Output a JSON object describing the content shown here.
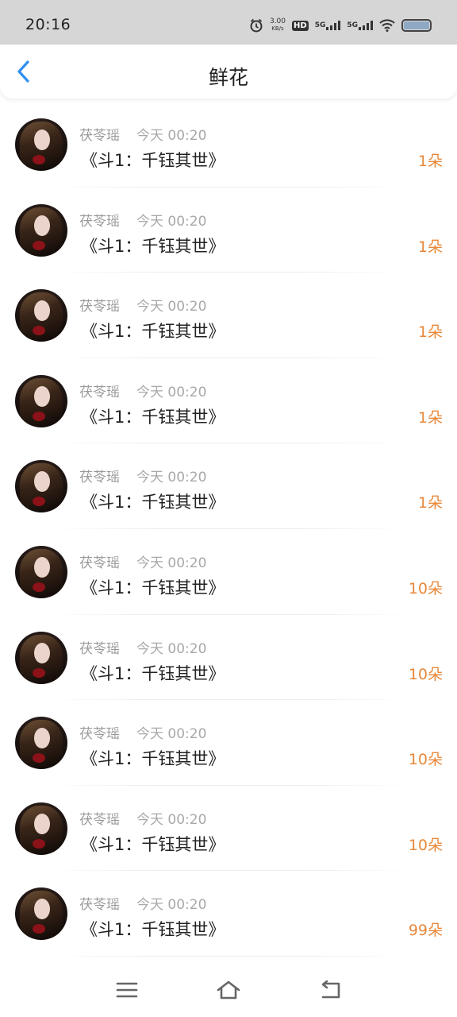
{
  "status_bar": {
    "time": "20:16",
    "net_speed_value": "3.00",
    "net_speed_unit": "KB/s",
    "hd_label": "HD",
    "sim1_label": "5G",
    "sim2_label": "5G"
  },
  "header": {
    "title": "鲜花"
  },
  "colors": {
    "accent_back": "#2f8ff0",
    "count_orange": "#e8883a"
  },
  "rows": [
    {
      "name": "茯苓瑶",
      "time": "今天 00:20",
      "book": "《斗1：千钰其世》",
      "count": "1朵"
    },
    {
      "name": "茯苓瑶",
      "time": "今天 00:20",
      "book": "《斗1：千钰其世》",
      "count": "1朵"
    },
    {
      "name": "茯苓瑶",
      "time": "今天 00:20",
      "book": "《斗1：千钰其世》",
      "count": "1朵"
    },
    {
      "name": "茯苓瑶",
      "time": "今天 00:20",
      "book": "《斗1：千钰其世》",
      "count": "1朵"
    },
    {
      "name": "茯苓瑶",
      "time": "今天 00:20",
      "book": "《斗1：千钰其世》",
      "count": "1朵"
    },
    {
      "name": "茯苓瑶",
      "time": "今天 00:20",
      "book": "《斗1：千钰其世》",
      "count": "10朵"
    },
    {
      "name": "茯苓瑶",
      "time": "今天 00:20",
      "book": "《斗1：千钰其世》",
      "count": "10朵"
    },
    {
      "name": "茯苓瑶",
      "time": "今天 00:20",
      "book": "《斗1：千钰其世》",
      "count": "10朵"
    },
    {
      "name": "茯苓瑶",
      "time": "今天 00:20",
      "book": "《斗1：千钰其世》",
      "count": "10朵"
    },
    {
      "name": "茯苓瑶",
      "time": "今天 00:20",
      "book": "《斗1：千钰其世》",
      "count": "99朵"
    }
  ],
  "navbar": {
    "icons": [
      "menu-icon",
      "home-icon",
      "back-icon"
    ]
  }
}
